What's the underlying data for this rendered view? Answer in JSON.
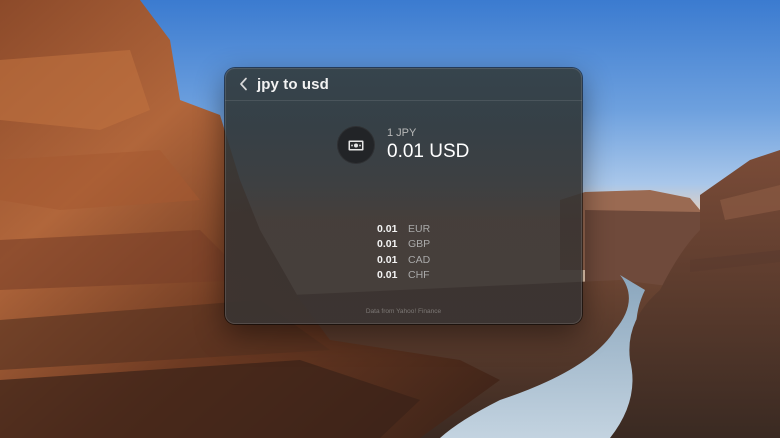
{
  "search": {
    "query": "jpy to usd"
  },
  "conversion": {
    "icon": "banknote-icon",
    "from": "1 JPY",
    "to": "0.01 USD"
  },
  "other_rates": [
    {
      "value": "0.01",
      "code": "EUR"
    },
    {
      "value": "0.01",
      "code": "GBP"
    },
    {
      "value": "0.01",
      "code": "CAD"
    },
    {
      "value": "0.01",
      "code": "CHF"
    }
  ],
  "footer": {
    "attribution": "Data from Yahoo! Finance"
  }
}
